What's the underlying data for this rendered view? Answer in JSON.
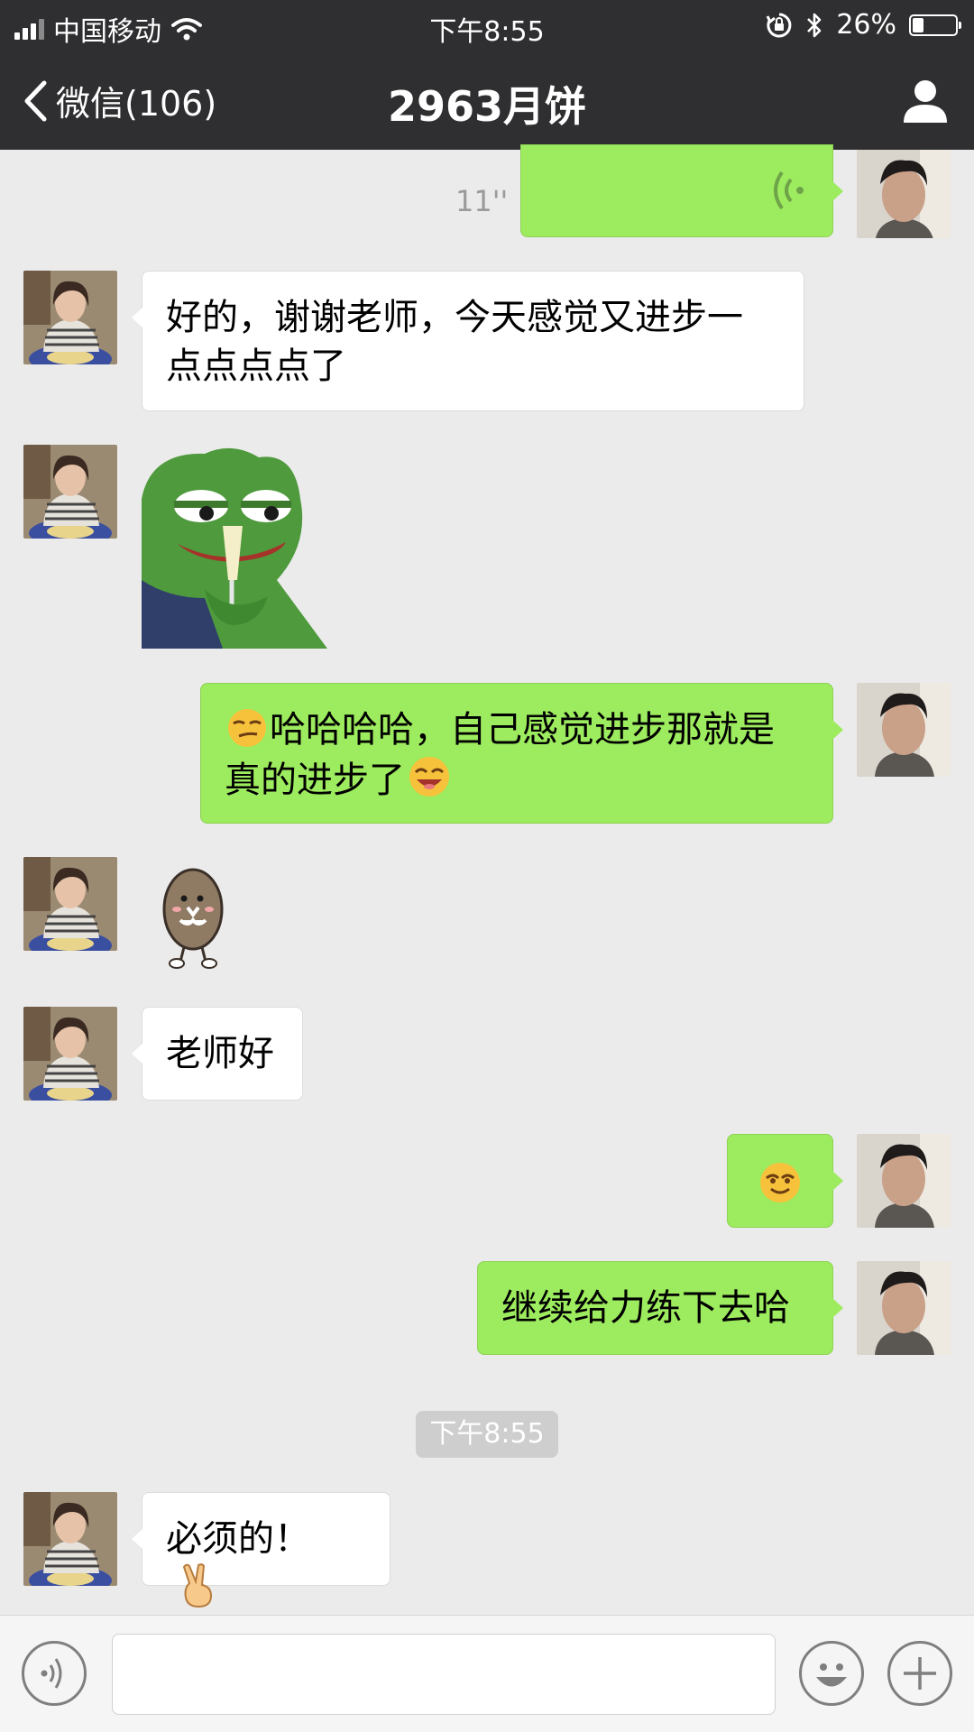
{
  "status_bar": {
    "carrier": "中国移动",
    "time": "下午8:55",
    "battery": "26%",
    "battery_level": 0.26
  },
  "nav": {
    "back_label": "微信(106)",
    "title": "2963月饼"
  },
  "messages": [
    {
      "side": "right",
      "type": "voice",
      "duration": "11''"
    },
    {
      "side": "left",
      "type": "text",
      "line1": "好的，谢谢老师，今天感觉又进步一",
      "line2": "点点点点了"
    },
    {
      "side": "left",
      "type": "sticker",
      "sticker": "pepe-frog-toasting-sticker"
    },
    {
      "side": "right",
      "type": "text",
      "line1": "哈哈哈哈，自己感觉进步那就是",
      "line2": "真的进步了",
      "emoji_before": "smirk-emoji",
      "emoji_after": "grin-emoji"
    },
    {
      "side": "left",
      "type": "sticker",
      "sticker": "potato-character-sticker"
    },
    {
      "side": "left",
      "type": "text",
      "text": "老师好"
    },
    {
      "side": "right",
      "type": "emoji",
      "emoji": "smile-emoji"
    },
    {
      "side": "right",
      "type": "text",
      "text": "继续给力练下去哈"
    },
    {
      "side": "left",
      "type": "text",
      "text": "必须的！",
      "emoji_after": "victory-hand-emoji"
    }
  ],
  "timestamp_divider": "下午8:55",
  "colors": {
    "bar_bg": "#2f2f31",
    "chat_bg": "#ebebeb",
    "sent_bubble": "#9deb5e",
    "received_bubble": "#ffffff"
  }
}
